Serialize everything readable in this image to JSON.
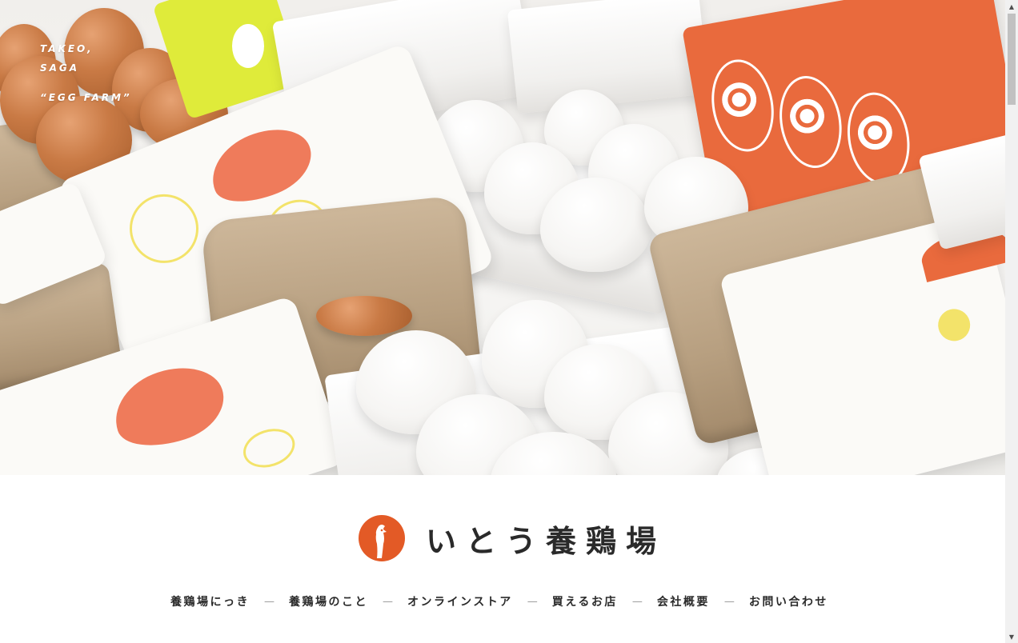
{
  "hero": {
    "tagline": {
      "line1": "TAKEO,",
      "line2": "SAGA",
      "line3": "“EGG FARM”"
    },
    "photo_alt": "egg cartons"
  },
  "brand": {
    "name": "いとう養鶏場",
    "logo_color": "#e35a26"
  },
  "nav": {
    "items": [
      {
        "label": "養鶏場にっき"
      },
      {
        "label": "養鶏場のこと"
      },
      {
        "label": "オンラインストア"
      },
      {
        "label": "買えるお店"
      },
      {
        "label": "会社概要"
      },
      {
        "label": "お問い合わせ"
      }
    ],
    "separator": "—"
  },
  "scrollbar": {
    "up_icon": "triangle-up",
    "down_icon": "triangle-down"
  }
}
